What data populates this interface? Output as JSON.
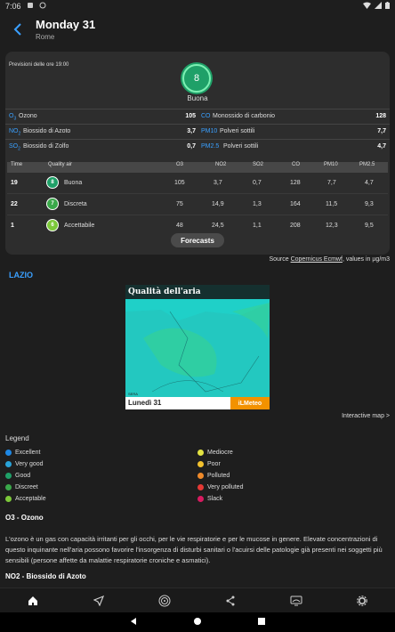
{
  "status": {
    "time": "7:06"
  },
  "header": {
    "title": "Monday 31",
    "subtitle": "Rome"
  },
  "card": {
    "forecast_time": "Previsioni delle ore 19:00",
    "aqi_value": "8",
    "aqi_label": "Buona",
    "pollutants": [
      {
        "abbr": "O3",
        "name": "Ozono",
        "value": "105",
        "abbr2": "CO",
        "name2": "Monossido di carbonio",
        "value2": "128"
      },
      {
        "abbr": "NO2",
        "name": "Biossido di Azoto",
        "value": "3,7",
        "abbr2": "PM10",
        "name2": "Polveri sottili",
        "value2": "7,7"
      },
      {
        "abbr": "SO2",
        "name": "Biossido di Zolfo",
        "value": "0,7",
        "abbr2": "PM2.5",
        "name2": "Polveri sottili",
        "value2": "4,7"
      }
    ],
    "table": {
      "headers": [
        "Time",
        "Quality air",
        "O3",
        "NO2",
        "SO2",
        "CO",
        "PM10",
        "PM2.5"
      ],
      "rows": [
        {
          "time": "19",
          "aqi": "8",
          "label": "Buona",
          "o3": "105",
          "no2": "3,7",
          "so2": "0,7",
          "co": "128",
          "pm10": "7,7",
          "pm25": "4,7",
          "color": "#1fa068"
        },
        {
          "time": "22",
          "aqi": "7",
          "label": "Discreta",
          "o3": "75",
          "no2": "14,9",
          "so2": "1,3",
          "co": "164",
          "pm10": "11,5",
          "pm25": "9,3",
          "color": "#3aa84a"
        },
        {
          "time": "1",
          "aqi": "6",
          "label": "Accettabile",
          "o3": "48",
          "no2": "24,5",
          "so2": "1,1",
          "co": "208",
          "pm10": "12,3",
          "pm25": "9,5",
          "color": "#7cc83a"
        }
      ]
    },
    "forecasts_button": "Forecasts"
  },
  "source": {
    "prefix": "Source",
    "link": "Copernicus Ecmwf",
    "suffix": ", values in µg/m3"
  },
  "region": "LAZIO",
  "map": {
    "title": "Qualità dell'aria",
    "sera": "SERA",
    "date": "Lunedì 31",
    "logo": "iLMeteo"
  },
  "interactive_map": "Interactive map >",
  "legend": {
    "title": "Legend",
    "left": [
      {
        "label": "Excellent",
        "color": "#1e88e5"
      },
      {
        "label": "Very good",
        "color": "#29a3d8"
      },
      {
        "label": "Good",
        "color": "#1fa068"
      },
      {
        "label": "Discreet",
        "color": "#3aa84a"
      },
      {
        "label": "Acceptable",
        "color": "#7cc83a"
      }
    ],
    "right": [
      {
        "label": "Mediocre",
        "color": "#e3e342"
      },
      {
        "label": "Poor",
        "color": "#f2c12e"
      },
      {
        "label": "Polluted",
        "color": "#f08a2a"
      },
      {
        "label": "Very polluted",
        "color": "#e53935"
      },
      {
        "label": "Slack",
        "color": "#d81b60"
      }
    ]
  },
  "ozone": {
    "heading": "O3 - Ozono",
    "text": "L'ozono è un gas con capacità irritanti per gli occhi, per le vie respiratorie e per le mucose in genere. Elevate concentrazioni di questo inquinante nell'aria possono favorire l'insorgenza di disturbi sanitari o l'acuirsi delle patologie già presenti nei soggetti più sensibili (persone affette da malattie respiratorie croniche e asmatici)."
  },
  "no2_heading": "NO2 - Biossido di Azoto",
  "bottom_nav": [
    "home-icon",
    "navigation-icon",
    "radar-icon",
    "share-icon",
    "map-icon",
    "settings-icon"
  ]
}
